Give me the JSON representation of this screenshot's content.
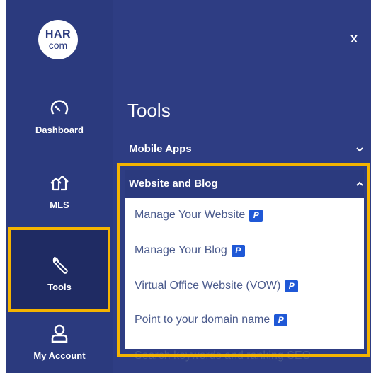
{
  "brand": {
    "logo_line1": "HAR",
    "logo_line2": "com"
  },
  "nav": [
    {
      "label": "Dashboard",
      "icon": "gauge-icon"
    },
    {
      "label": "MLS",
      "icon": "houses-icon"
    },
    {
      "label": "Tools",
      "icon": "wrench-icon"
    },
    {
      "label": "My Account",
      "icon": "user-icon"
    }
  ],
  "panel": {
    "close_label": "x",
    "title": "Tools",
    "mobile_apps": "Mobile Apps",
    "website_and_blog": "Website and Blog",
    "sub_items": [
      {
        "label": "Manage Your Website",
        "badge": "P"
      },
      {
        "label": "Manage Your Blog",
        "badge": "P"
      },
      {
        "label": "Virtual Office Website (VOW)",
        "badge": "P"
      },
      {
        "label": "Point to your domain name",
        "badge": "P"
      }
    ],
    "peek_item": "Search keywords and ranking SEO"
  },
  "colors": {
    "rail": "#2b3a7e",
    "panel": "#2e3d83",
    "highlight": "#f5b400",
    "badge": "#1f58d6"
  }
}
